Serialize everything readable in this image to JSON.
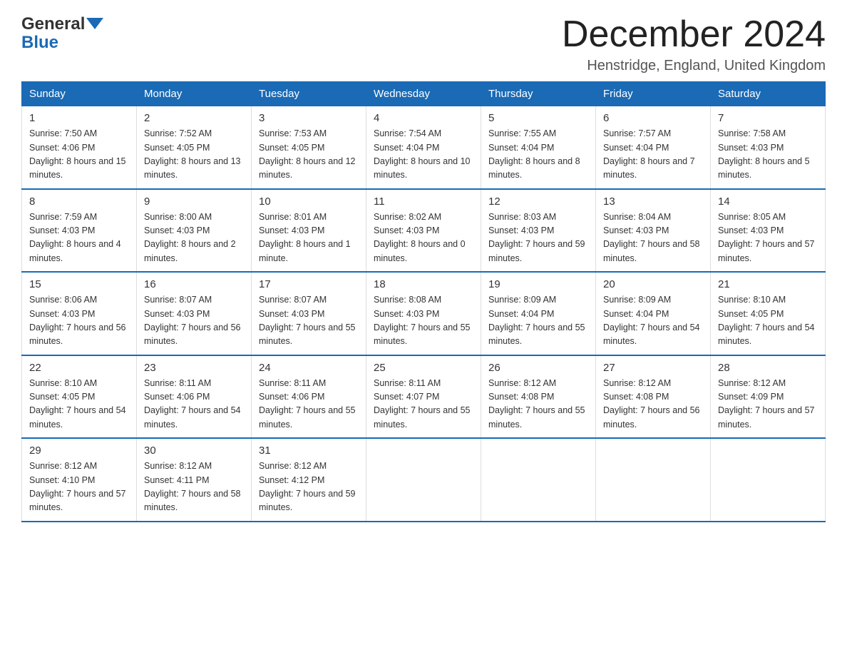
{
  "header": {
    "logo_general": "General",
    "logo_blue": "Blue",
    "month_title": "December 2024",
    "location": "Henstridge, England, United Kingdom"
  },
  "weekdays": [
    "Sunday",
    "Monday",
    "Tuesday",
    "Wednesday",
    "Thursday",
    "Friday",
    "Saturday"
  ],
  "weeks": [
    [
      {
        "day": "1",
        "sunrise": "7:50 AM",
        "sunset": "4:06 PM",
        "daylight": "8 hours and 15 minutes."
      },
      {
        "day": "2",
        "sunrise": "7:52 AM",
        "sunset": "4:05 PM",
        "daylight": "8 hours and 13 minutes."
      },
      {
        "day": "3",
        "sunrise": "7:53 AM",
        "sunset": "4:05 PM",
        "daylight": "8 hours and 12 minutes."
      },
      {
        "day": "4",
        "sunrise": "7:54 AM",
        "sunset": "4:04 PM",
        "daylight": "8 hours and 10 minutes."
      },
      {
        "day": "5",
        "sunrise": "7:55 AM",
        "sunset": "4:04 PM",
        "daylight": "8 hours and 8 minutes."
      },
      {
        "day": "6",
        "sunrise": "7:57 AM",
        "sunset": "4:04 PM",
        "daylight": "8 hours and 7 minutes."
      },
      {
        "day": "7",
        "sunrise": "7:58 AM",
        "sunset": "4:03 PM",
        "daylight": "8 hours and 5 minutes."
      }
    ],
    [
      {
        "day": "8",
        "sunrise": "7:59 AM",
        "sunset": "4:03 PM",
        "daylight": "8 hours and 4 minutes."
      },
      {
        "day": "9",
        "sunrise": "8:00 AM",
        "sunset": "4:03 PM",
        "daylight": "8 hours and 2 minutes."
      },
      {
        "day": "10",
        "sunrise": "8:01 AM",
        "sunset": "4:03 PM",
        "daylight": "8 hours and 1 minute."
      },
      {
        "day": "11",
        "sunrise": "8:02 AM",
        "sunset": "4:03 PM",
        "daylight": "8 hours and 0 minutes."
      },
      {
        "day": "12",
        "sunrise": "8:03 AM",
        "sunset": "4:03 PM",
        "daylight": "7 hours and 59 minutes."
      },
      {
        "day": "13",
        "sunrise": "8:04 AM",
        "sunset": "4:03 PM",
        "daylight": "7 hours and 58 minutes."
      },
      {
        "day": "14",
        "sunrise": "8:05 AM",
        "sunset": "4:03 PM",
        "daylight": "7 hours and 57 minutes."
      }
    ],
    [
      {
        "day": "15",
        "sunrise": "8:06 AM",
        "sunset": "4:03 PM",
        "daylight": "7 hours and 56 minutes."
      },
      {
        "day": "16",
        "sunrise": "8:07 AM",
        "sunset": "4:03 PM",
        "daylight": "7 hours and 56 minutes."
      },
      {
        "day": "17",
        "sunrise": "8:07 AM",
        "sunset": "4:03 PM",
        "daylight": "7 hours and 55 minutes."
      },
      {
        "day": "18",
        "sunrise": "8:08 AM",
        "sunset": "4:03 PM",
        "daylight": "7 hours and 55 minutes."
      },
      {
        "day": "19",
        "sunrise": "8:09 AM",
        "sunset": "4:04 PM",
        "daylight": "7 hours and 55 minutes."
      },
      {
        "day": "20",
        "sunrise": "8:09 AM",
        "sunset": "4:04 PM",
        "daylight": "7 hours and 54 minutes."
      },
      {
        "day": "21",
        "sunrise": "8:10 AM",
        "sunset": "4:05 PM",
        "daylight": "7 hours and 54 minutes."
      }
    ],
    [
      {
        "day": "22",
        "sunrise": "8:10 AM",
        "sunset": "4:05 PM",
        "daylight": "7 hours and 54 minutes."
      },
      {
        "day": "23",
        "sunrise": "8:11 AM",
        "sunset": "4:06 PM",
        "daylight": "7 hours and 54 minutes."
      },
      {
        "day": "24",
        "sunrise": "8:11 AM",
        "sunset": "4:06 PM",
        "daylight": "7 hours and 55 minutes."
      },
      {
        "day": "25",
        "sunrise": "8:11 AM",
        "sunset": "4:07 PM",
        "daylight": "7 hours and 55 minutes."
      },
      {
        "day": "26",
        "sunrise": "8:12 AM",
        "sunset": "4:08 PM",
        "daylight": "7 hours and 55 minutes."
      },
      {
        "day": "27",
        "sunrise": "8:12 AM",
        "sunset": "4:08 PM",
        "daylight": "7 hours and 56 minutes."
      },
      {
        "day": "28",
        "sunrise": "8:12 AM",
        "sunset": "4:09 PM",
        "daylight": "7 hours and 57 minutes."
      }
    ],
    [
      {
        "day": "29",
        "sunrise": "8:12 AM",
        "sunset": "4:10 PM",
        "daylight": "7 hours and 57 minutes."
      },
      {
        "day": "30",
        "sunrise": "8:12 AM",
        "sunset": "4:11 PM",
        "daylight": "7 hours and 58 minutes."
      },
      {
        "day": "31",
        "sunrise": "8:12 AM",
        "sunset": "4:12 PM",
        "daylight": "7 hours and 59 minutes."
      },
      null,
      null,
      null,
      null
    ]
  ]
}
